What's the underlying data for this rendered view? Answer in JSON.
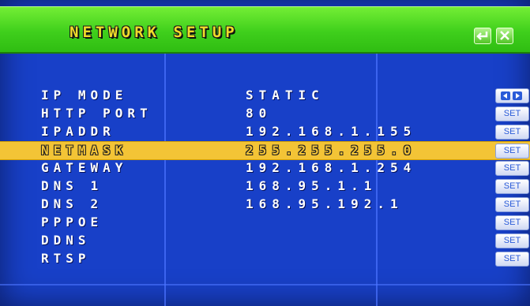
{
  "header": {
    "title": "NETWORK SETUP",
    "buttons": [
      {
        "name": "enter-icon"
      },
      {
        "name": "close-icon"
      }
    ]
  },
  "settings": [
    {
      "label": "IP MODE",
      "value": "STATIC",
      "control": "arrows",
      "control_label": ""
    },
    {
      "label": "HTTP PORT",
      "value": "80",
      "control": "set",
      "control_label": "SET"
    },
    {
      "label": "IPADDR",
      "value": "192.168.1.155",
      "control": "set",
      "control_label": "SET"
    },
    {
      "label": "NETMASK",
      "value": "255.255.255.0",
      "control": "set",
      "control_label": "SET",
      "selected": true
    },
    {
      "label": "GATEWAY",
      "value": "192.168.1.254",
      "control": "set",
      "control_label": "SET"
    },
    {
      "label": "DNS 1",
      "value": "168.95.1.1",
      "control": "set",
      "control_label": "SET"
    },
    {
      "label": "DNS 2",
      "value": "168.95.192.1",
      "control": "set",
      "control_label": "SET"
    },
    {
      "label": "PPPOE",
      "value": "",
      "control": "set",
      "control_label": "SET"
    },
    {
      "label": "DDNS",
      "value": "",
      "control": "set",
      "control_label": "SET"
    },
    {
      "label": "RTSP",
      "value": "",
      "control": "set",
      "control_label": "SET"
    }
  ],
  "colors": {
    "background": "#1840c8",
    "title_bar": "#4fd624",
    "title_text": "#f0dc2a",
    "selected_row": "#f3c436"
  }
}
